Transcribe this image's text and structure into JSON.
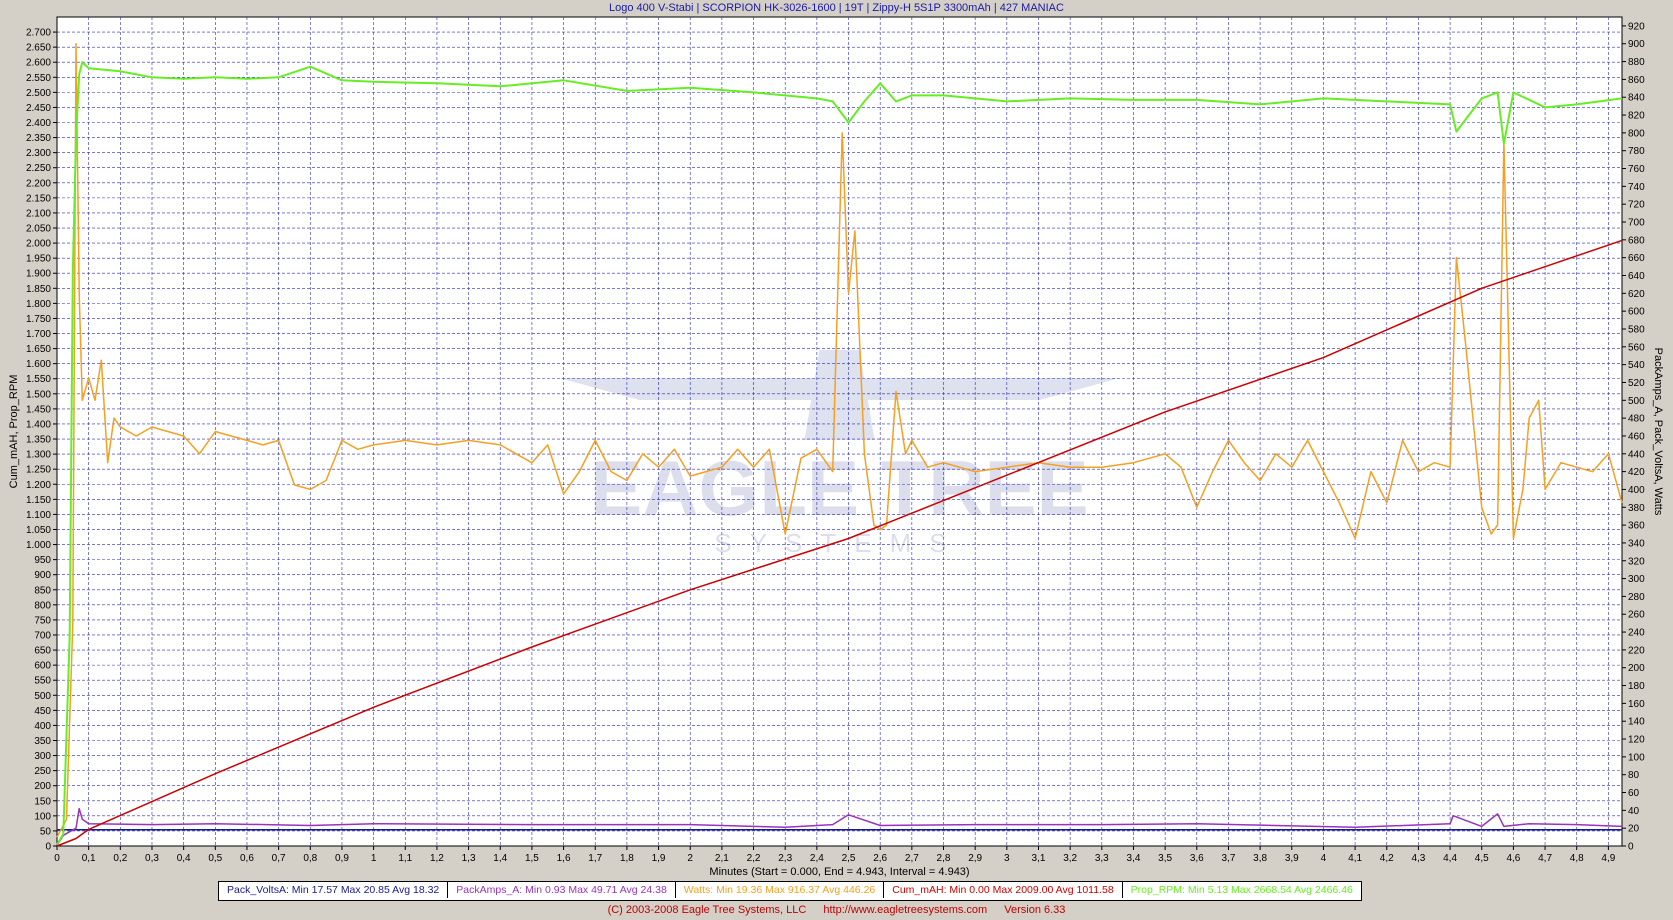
{
  "window": {
    "title": "Logo 400 V-Stabi | SCORPION HK-3026-1600 | 19T | Zippy-H 5S1P 3300mAh | 427 MANIAC"
  },
  "footer": {
    "copyright": "(C) 2003-2008 Eagle Tree Systems, LLC",
    "url": "http://www.eagletreesystems.com",
    "version": "Version 6.33"
  },
  "watermark": {
    "line1": "EAGLE TREE",
    "line2": "SYSTEMS"
  },
  "colors": {
    "background": "#d4d0c8",
    "plot_bg": "#ffffff",
    "grid": "#2a2ab8",
    "Pack_VoltsA": "#1a1a90",
    "PackAmps_A": "#9933bb",
    "Watts": "#f5a020",
    "Cum_mAH": "#cc0000",
    "Prop_RPM": "#66ee22"
  },
  "chart_data": {
    "type": "line",
    "title": "Logo 400 V-Stabi | SCORPION HK-3026-1600 | 19T | Zippy-H 5S1P 3300mAh | 427 MANIAC",
    "xlabel": "Minutes (Start = 0.000,  End = 4.943,  Interval =  4.943)",
    "ylabel_left": "Cum_mAH, Prop_RPM",
    "ylabel_right": "PackAmps_A, Pack_VoltsA, Watts",
    "xlim": [
      0,
      4.943
    ],
    "ylim_left": [
      0,
      2750
    ],
    "ylim_right": [
      0,
      930
    ],
    "grid": true,
    "x_ticks": [
      "0",
      "0,1",
      "0,2",
      "0,3",
      "0,4",
      "0,5",
      "0,6",
      "0,7",
      "0,8",
      "0,9",
      "1",
      "1,1",
      "1,2",
      "1,3",
      "1,4",
      "1,5",
      "1,6",
      "1,7",
      "1,8",
      "1,9",
      "2",
      "2,1",
      "2,2",
      "2,3",
      "2,4",
      "2,5",
      "2,6",
      "2,7",
      "2,8",
      "2,9",
      "3",
      "3,1",
      "3,2",
      "3,3",
      "3,4",
      "3,5",
      "3,6",
      "3,7",
      "3,8",
      "3,9",
      "4",
      "4,1",
      "4,2",
      "4,3",
      "4,4",
      "4,5",
      "4,6",
      "4,7",
      "4,8",
      "4,9"
    ],
    "left_ticks": [
      "0",
      "50",
      "100",
      "150",
      "200",
      "250",
      "300",
      "350",
      "400",
      "450",
      "500",
      "550",
      "600",
      "650",
      "700",
      "750",
      "800",
      "850",
      "900",
      "950",
      "1.000",
      "1.050",
      "1.100",
      "1.150",
      "1.200",
      "1.250",
      "1.300",
      "1.350",
      "1.400",
      "1.450",
      "1.500",
      "1.550",
      "1.600",
      "1.650",
      "1.700",
      "1.750",
      "1.800",
      "1.850",
      "1.900",
      "1.950",
      "2.000",
      "2.050",
      "2.100",
      "2.150",
      "2.200",
      "2.250",
      "2.300",
      "2.350",
      "2.400",
      "2.450",
      "2.500",
      "2.550",
      "2.600",
      "2.650",
      "2.700"
    ],
    "right_ticks": [
      "0",
      "20",
      "40",
      "60",
      "80",
      "100",
      "120",
      "140",
      "160",
      "180",
      "200",
      "220",
      "240",
      "260",
      "280",
      "300",
      "320",
      "340",
      "360",
      "380",
      "400",
      "420",
      "440",
      "460",
      "480",
      "500",
      "520",
      "540",
      "560",
      "580",
      "600",
      "620",
      "640",
      "660",
      "680",
      "700",
      "720",
      "740",
      "760",
      "780",
      "800",
      "820",
      "840",
      "860",
      "880",
      "900",
      "920"
    ],
    "series": [
      {
        "name": "Pack_VoltsA",
        "axis": "right",
        "min": "17.57",
        "max": "20.85",
        "avg": "18.32",
        "x": [
          0,
          4.943
        ],
        "y": [
          18.3,
          18.3
        ]
      },
      {
        "name": "PackAmps_A",
        "axis": "right",
        "min": "0.93",
        "max": "49.71",
        "avg": "24.38",
        "x": [
          0,
          0.02,
          0.06,
          0.07,
          0.08,
          0.1,
          0.3,
          0.5,
          0.8,
          1.0,
          1.5,
          2.0,
          2.3,
          2.45,
          2.5,
          2.6,
          2.9,
          3.3,
          3.6,
          4.1,
          4.4,
          4.41,
          4.5,
          4.55,
          4.57,
          4.65,
          4.8,
          4.943
        ],
        "y": [
          0.9,
          12,
          20,
          42,
          30,
          25,
          24,
          25,
          23,
          25,
          24,
          24,
          21,
          24,
          35,
          23,
          24,
          24,
          25,
          21,
          25,
          34,
          22,
          36,
          22,
          25,
          24,
          22
        ]
      },
      {
        "name": "Watts",
        "axis": "right",
        "min": "19.36",
        "max": "916.37",
        "avg": "446.26",
        "x": [
          0,
          0.03,
          0.05,
          0.06,
          0.07,
          0.08,
          0.1,
          0.12,
          0.14,
          0.16,
          0.18,
          0.2,
          0.25,
          0.3,
          0.35,
          0.4,
          0.45,
          0.5,
          0.55,
          0.6,
          0.65,
          0.7,
          0.75,
          0.8,
          0.85,
          0.9,
          0.95,
          1.0,
          1.1,
          1.2,
          1.3,
          1.4,
          1.5,
          1.55,
          1.6,
          1.65,
          1.7,
          1.75,
          1.8,
          1.85,
          1.9,
          1.95,
          2.0,
          2.05,
          2.1,
          2.15,
          2.2,
          2.25,
          2.3,
          2.35,
          2.4,
          2.45,
          2.48,
          2.5,
          2.52,
          2.55,
          2.58,
          2.6,
          2.62,
          2.65,
          2.68,
          2.7,
          2.75,
          2.8,
          2.9,
          3.0,
          3.1,
          3.2,
          3.3,
          3.4,
          3.5,
          3.55,
          3.6,
          3.65,
          3.7,
          3.75,
          3.8,
          3.85,
          3.9,
          3.95,
          4.0,
          4.05,
          4.1,
          4.15,
          4.2,
          4.25,
          4.3,
          4.35,
          4.4,
          4.42,
          4.45,
          4.5,
          4.53,
          4.55,
          4.57,
          4.6,
          4.63,
          4.65,
          4.68,
          4.7,
          4.75,
          4.8,
          4.85,
          4.9,
          4.943
        ],
        "y": [
          10,
          30,
          250,
          900,
          620,
          500,
          525,
          500,
          545,
          430,
          480,
          470,
          460,
          470,
          465,
          460,
          440,
          465,
          460,
          455,
          450,
          455,
          405,
          400,
          410,
          455,
          445,
          450,
          455,
          450,
          455,
          450,
          430,
          450,
          395,
          420,
          455,
          420,
          410,
          440,
          425,
          445,
          415,
          420,
          425,
          445,
          425,
          445,
          350,
          435,
          445,
          420,
          800,
          620,
          690,
          440,
          360,
          355,
          360,
          510,
          440,
          455,
          425,
          430,
          420,
          425,
          430,
          425,
          425,
          430,
          440,
          425,
          380,
          420,
          455,
          430,
          410,
          440,
          425,
          455,
          420,
          385,
          345,
          420,
          385,
          455,
          420,
          430,
          425,
          660,
          560,
          380,
          350,
          360,
          790,
          345,
          400,
          480,
          500,
          400,
          430,
          425,
          420,
          440,
          385
        ]
      },
      {
        "name": "Cum_mAH",
        "axis": "left",
        "min": "0.00",
        "max": "2009.00",
        "avg": "1011.58",
        "x": [
          0,
          0.06,
          0.1,
          0.5,
          1.0,
          1.5,
          2.0,
          2.5,
          3.0,
          3.5,
          4.0,
          4.5,
          4.943
        ],
        "y": [
          0,
          25,
          55,
          240,
          460,
          660,
          850,
          1020,
          1230,
          1440,
          1620,
          1850,
          2009
        ]
      },
      {
        "name": "Prop_RPM",
        "axis": "left",
        "min": "5.13",
        "max": "2668.54",
        "avg": "2466.46",
        "x": [
          0,
          0.02,
          0.04,
          0.05,
          0.06,
          0.07,
          0.08,
          0.1,
          0.2,
          0.3,
          0.4,
          0.5,
          0.6,
          0.7,
          0.8,
          0.9,
          1.0,
          1.2,
          1.4,
          1.6,
          1.8,
          2.0,
          2.2,
          2.4,
          2.45,
          2.5,
          2.55,
          2.6,
          2.65,
          2.7,
          2.8,
          3.0,
          3.2,
          3.4,
          3.6,
          3.8,
          4.0,
          4.2,
          4.4,
          4.42,
          4.5,
          4.55,
          4.57,
          4.6,
          4.7,
          4.8,
          4.943
        ],
        "y": [
          5,
          40,
          700,
          1900,
          2350,
          2560,
          2600,
          2580,
          2570,
          2550,
          2545,
          2550,
          2545,
          2550,
          2585,
          2540,
          2535,
          2530,
          2520,
          2540,
          2505,
          2515,
          2500,
          2480,
          2470,
          2400,
          2470,
          2530,
          2470,
          2490,
          2490,
          2470,
          2480,
          2475,
          2475,
          2460,
          2480,
          2470,
          2460,
          2370,
          2480,
          2500,
          2330,
          2500,
          2450,
          2460,
          2480
        ]
      }
    ]
  }
}
